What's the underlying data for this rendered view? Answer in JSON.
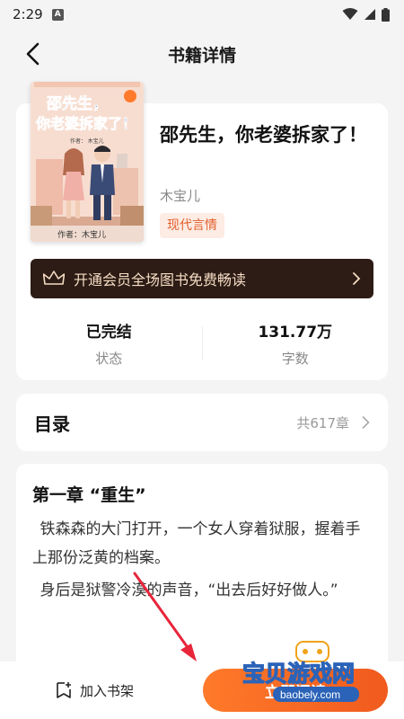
{
  "status_bar": {
    "time": "2:29",
    "indicator": "A"
  },
  "header": {
    "title": "书籍详情"
  },
  "book": {
    "title": "邵先生，你老婆拆家了！",
    "author": "木宝儿",
    "genre": "现代言情",
    "cover": {
      "title_line1": "邵先生，",
      "title_line2": "你老婆拆家了！",
      "author_line_top": "作者：  木宝儿",
      "author_line_bottom": "作者：木宝儿"
    }
  },
  "vip_banner": {
    "text": "开通会员全场图书免费畅读"
  },
  "stats": [
    {
      "value": "已完结",
      "label": "状态"
    },
    {
      "value": "131.77万",
      "label": "字数"
    }
  ],
  "toc": {
    "title": "目录",
    "count": "共617章"
  },
  "chapter": {
    "title": "第一章 “重生”",
    "paragraphs": [
      "铁森森的大门打开，一个女人穿着狱服，握着手上那份泛黄的档案。",
      "身后是狱警冷漠的声音，“出去后好好做人。”"
    ]
  },
  "bottom_bar": {
    "shelf_label": "加入书架",
    "read_label": "立即阅读"
  },
  "watermark": {
    "line1": "宝贝游戏网",
    "line2": "baobely.com"
  },
  "colors": {
    "accent": "#f05a1e",
    "vip_bg": "#2c1c15",
    "vip_text": "#f5dcc3",
    "tag_bg": "#fdece4",
    "tag_text": "#e45e2c"
  }
}
